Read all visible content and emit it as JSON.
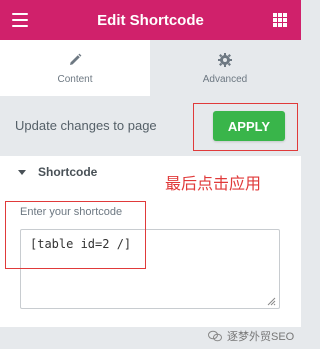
{
  "header": {
    "title": "Edit Shortcode",
    "menu_icon": "hamburger-menu-icon",
    "apps_icon": "grid-apps-icon"
  },
  "tabs": [
    {
      "label": "Content",
      "icon": "pencil-icon",
      "active": true
    },
    {
      "label": "Advanced",
      "icon": "gear-icon",
      "active": false
    }
  ],
  "update": {
    "label": "Update changes to page",
    "apply_label": "APPLY"
  },
  "section": {
    "title": "Shortcode",
    "field_label": "Enter your shortcode",
    "value": "[table id=2 /]"
  },
  "annotation": {
    "text": "最后点击应用"
  },
  "watermark": {
    "text": "逐梦外贸SEO"
  },
  "colors": {
    "header_bg": "#d0216b",
    "apply_bg": "#39b54a",
    "annotation_red": "#e03a3a"
  }
}
